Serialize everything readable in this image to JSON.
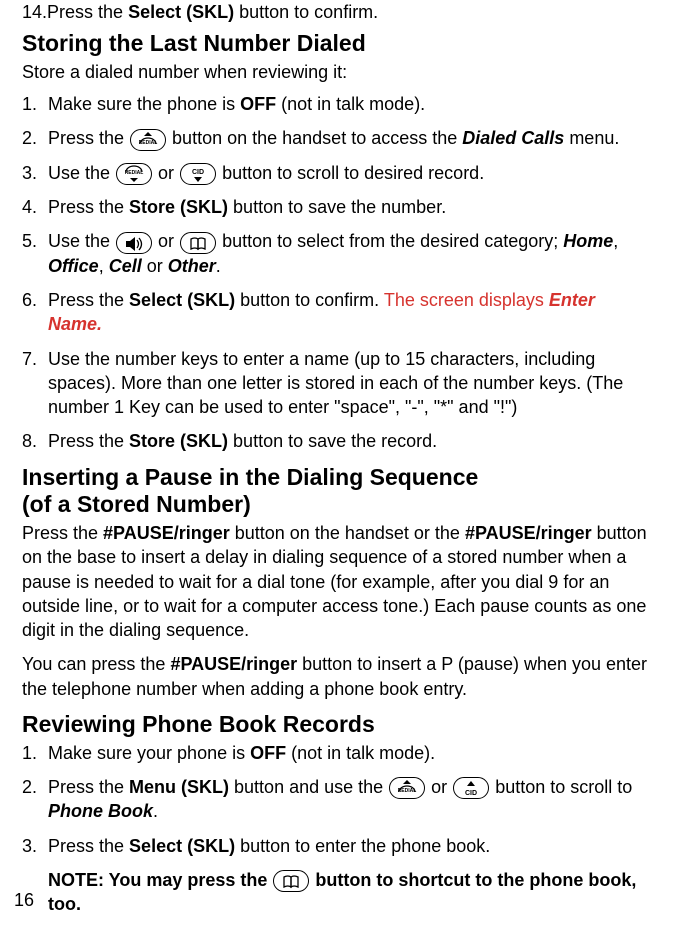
{
  "intro": {
    "num": "14.",
    "t1": "Press the ",
    "b1": "Select (SKL)",
    "t2": " button to confirm."
  },
  "h1": "Storing the Last Number Dialed",
  "h1_sub": "Store a dialed number when reviewing it:",
  "list1": {
    "i1": {
      "t1": "Make sure the phone is ",
      "b1": "OFF",
      "t2": " (not in talk mode)."
    },
    "i2": {
      "t1": "Press the ",
      "t2": " button on the handset to access the ",
      "bi1": "Dialed Calls",
      "t3": " menu."
    },
    "i3": {
      "t1": "Use the ",
      "t2": " or ",
      "t3": " button to scroll to desired record."
    },
    "i4": {
      "t1": "Press the ",
      "b1": "Store (SKL)",
      "t2": " button to save the number."
    },
    "i5": {
      "t1": "Use the ",
      "t2": " or ",
      "t3": " button to select from the desired category; ",
      "bi1": "Home",
      "t4": ", ",
      "bi2": "Office",
      "t5": ", ",
      "bi3": "Cell",
      "t6": " or ",
      "bi4": "Other",
      "t7": "."
    },
    "i6": {
      "t1": "Press the ",
      "b1": "Select (SKL)",
      "t2": " button to confirm. ",
      "r1": "The screen displays ",
      "bi1": "Enter Name."
    },
    "i7": {
      "t1": "Use the number keys to enter a name (up to 15 characters, including spaces). More than one letter is stored in each of the number keys. (The number 1 Key can be used to enter \"space\", \"-\", \"*\" and \"!\")"
    },
    "i8": {
      "t1": "Press the ",
      "b1": "Store (SKL)",
      "t2": " button to save the record."
    }
  },
  "h2": {
    "l1": "Inserting a Pause in the Dialing Sequence",
    "l2": "(of a Stored Number)"
  },
  "p2a": {
    "t1": "Press the ",
    "b1": "#PAUSE/ringer",
    "t2": " button on the handset or the ",
    "b2": "#PAUSE/ringer",
    "t3": " button on the base to insert a delay in dialing sequence of a stored number when a pause is needed to wait for a dial tone (for example, after you dial 9 for an outside line, or to wait for a computer access tone.) Each pause counts as one digit in the dialing sequence."
  },
  "p2b": {
    "t1": "You can press the ",
    "b1": "#PAUSE/ringer",
    "t2": " button to insert a P (pause) when you enter the telephone number when adding a phone book entry."
  },
  "h3": "Reviewing Phone Book Records",
  "list3": {
    "i1": {
      "t1": "Make sure your phone is ",
      "b1": "OFF",
      "t2": " (not in talk mode)."
    },
    "i2": {
      "t1": "Press the ",
      "b1": "Menu (SKL)",
      "t2": " button and use the ",
      "t3": " or ",
      "t4": " button to scroll to ",
      "bi1": "Phone Book",
      "t5": "."
    },
    "i3": {
      "t1": "Press the ",
      "b1": "Select (SKL)",
      "t2": " button to enter the phone book."
    }
  },
  "note": {
    "t1": "NOTE: You may press the ",
    "t2": " button to shortcut to the phone book, too."
  },
  "page": "16"
}
